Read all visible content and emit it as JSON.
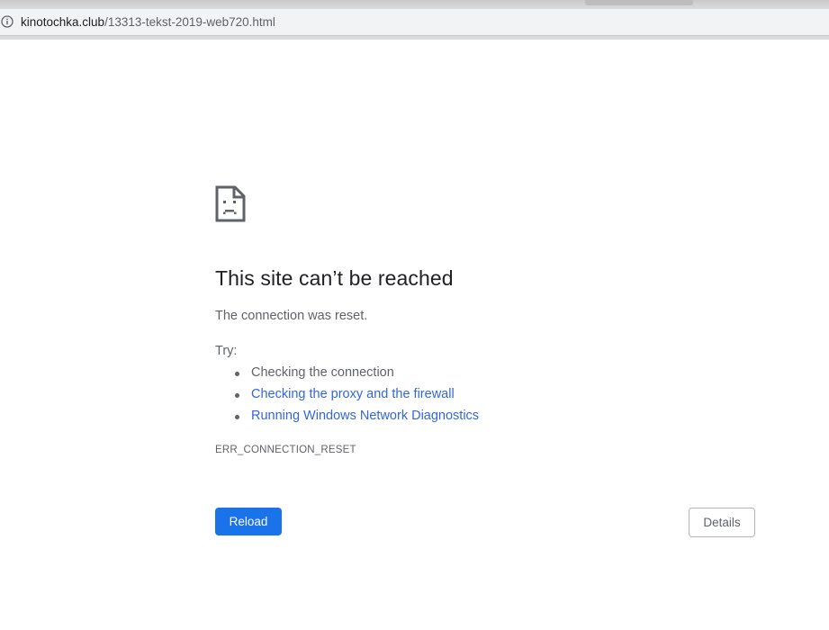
{
  "browser": {
    "url_host": "kinotochka.club",
    "url_path": "/13313-tekst-2019-web720.html",
    "site_info_icon": "info-circle-icon"
  },
  "error_page": {
    "icon": "sad-page-icon",
    "headline": "This site can’t be reached",
    "summary": "The connection was reset.",
    "try_label": "Try:",
    "suggestions": [
      {
        "text": "Checking the connection",
        "is_link": false
      },
      {
        "text": "Checking the proxy and the firewall",
        "is_link": true
      },
      {
        "text": "Running Windows Network Diagnostics",
        "is_link": true
      }
    ],
    "error_code": "ERR_CONNECTION_RESET",
    "reload_label": "Reload",
    "details_label": "Details"
  },
  "colors": {
    "primary_button": "#1a73e8",
    "link": "#3367d6",
    "headline": "#202124",
    "body_text": "#5f6368"
  }
}
